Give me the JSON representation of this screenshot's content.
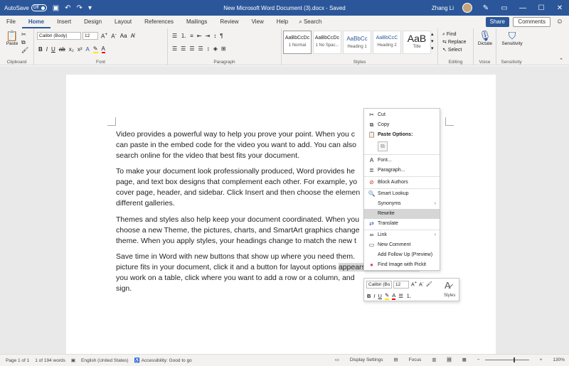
{
  "titlebar": {
    "autosave_label": "AutoSave",
    "autosave_state": "Off",
    "doc_title": "New Microsoft Word Document (3).docx  -  Saved",
    "user_name": "Zhang Li"
  },
  "tabs": [
    "File",
    "Home",
    "Insert",
    "Design",
    "Layout",
    "References",
    "Mailings",
    "Review",
    "View",
    "Help"
  ],
  "search_label": "Search",
  "share_label": "Share",
  "comments_label": "Comments",
  "ribbon": {
    "paste_label": "Paste",
    "font_name": "Calibri (Body)",
    "font_size": "12",
    "styles": [
      {
        "sample": "AaBbCcDc",
        "name": "1 Normal"
      },
      {
        "sample": "AaBbCcDc",
        "name": "1 No Spac..."
      },
      {
        "sample": "AaBbCc",
        "name": "Heading 1"
      },
      {
        "sample": "AaBbCcC",
        "name": "Heading 2"
      },
      {
        "sample": "AaB",
        "name": "Title"
      }
    ],
    "find_label": "Find",
    "replace_label": "Replace",
    "select_label": "Select",
    "dictate_label": "Dictate",
    "sensitivity_label": "Sensitivity",
    "group_labels": {
      "clipboard": "Clipboard",
      "font": "Font",
      "paragraph": "Paragraph",
      "styles": "Styles",
      "editing": "Editing",
      "voice": "Voice",
      "sensitivity": "Sensitivity"
    }
  },
  "document": {
    "paragraphs": [
      [
        "Video provides a powerful way to help you prove your point. When you c",
        "can paste in the embed code for the video you want to add. You can also",
        "search online for the video that best fits your document."
      ],
      [
        "To make your document look professionally produced, Word provides he",
        "page, and text box designs that complement each other. For example, yo",
        "cover page, header, and sidebar. Click Insert and then choose the elemen",
        "different galleries."
      ],
      [
        "Themes and styles also help keep your document coordinated. When you",
        "choose a new Theme, the pictures, charts, and SmartArt graphics change",
        "theme. When you apply styles, your headings change to match the new t"
      ],
      [
        "Save time in Word with new buttons that show up where you need them.",
        "picture fits in your document, click it and a button for layout options ",
        "you work on a table, click where you want to add a row or a column, and",
        "sign."
      ]
    ],
    "highlight_text": "appears next to it. When"
  },
  "context_menu": {
    "items": [
      {
        "label": "Cut",
        "icon": "scissors-icon",
        "glyph": "✂"
      },
      {
        "label": "Copy",
        "icon": "copy-icon",
        "glyph": "⧉"
      },
      {
        "label": "Paste Options:",
        "icon": "paste-icon",
        "glyph": "📋"
      },
      {
        "label": "Font...",
        "icon": "font-icon",
        "glyph": "A"
      },
      {
        "label": "Paragraph...",
        "icon": "paragraph-icon",
        "glyph": "≣"
      },
      {
        "label": "Block Authors",
        "icon": "block-authors-icon",
        "glyph": "⊘"
      },
      {
        "label": "Smart Lookup",
        "icon": "smart-lookup-icon",
        "glyph": "🔍"
      },
      {
        "label": "Synonyms",
        "icon": "",
        "glyph": ""
      },
      {
        "label": "Rewrite",
        "icon": "",
        "glyph": ""
      },
      {
        "label": "Translate",
        "icon": "translate-icon",
        "glyph": "⇄"
      },
      {
        "label": "Link",
        "icon": "link-icon",
        "glyph": "∞"
      },
      {
        "label": "New Comment",
        "icon": "comment-icon",
        "glyph": "▭"
      },
      {
        "label": "Add Follow Up (Preview)",
        "icon": "",
        "glyph": ""
      },
      {
        "label": "Find Image with Pickit",
        "icon": "pickit-icon",
        "glyph": "●"
      }
    ]
  },
  "mini_toolbar": {
    "font_name": "Calibri (Bo",
    "font_size": "12",
    "styles_label": "Styles"
  },
  "statusbar": {
    "page": "Page 1 of 1",
    "words": "1 of 194 words",
    "language": "English (United States)",
    "accessibility": "Accessibility: Good to go",
    "display_settings": "Display Settings",
    "focus": "Focus",
    "zoom": "130%"
  },
  "colors": {
    "brand": "#2b579a",
    "ribbon_bg": "#f3f2f1",
    "canvas_bg": "#e9e9e9"
  }
}
